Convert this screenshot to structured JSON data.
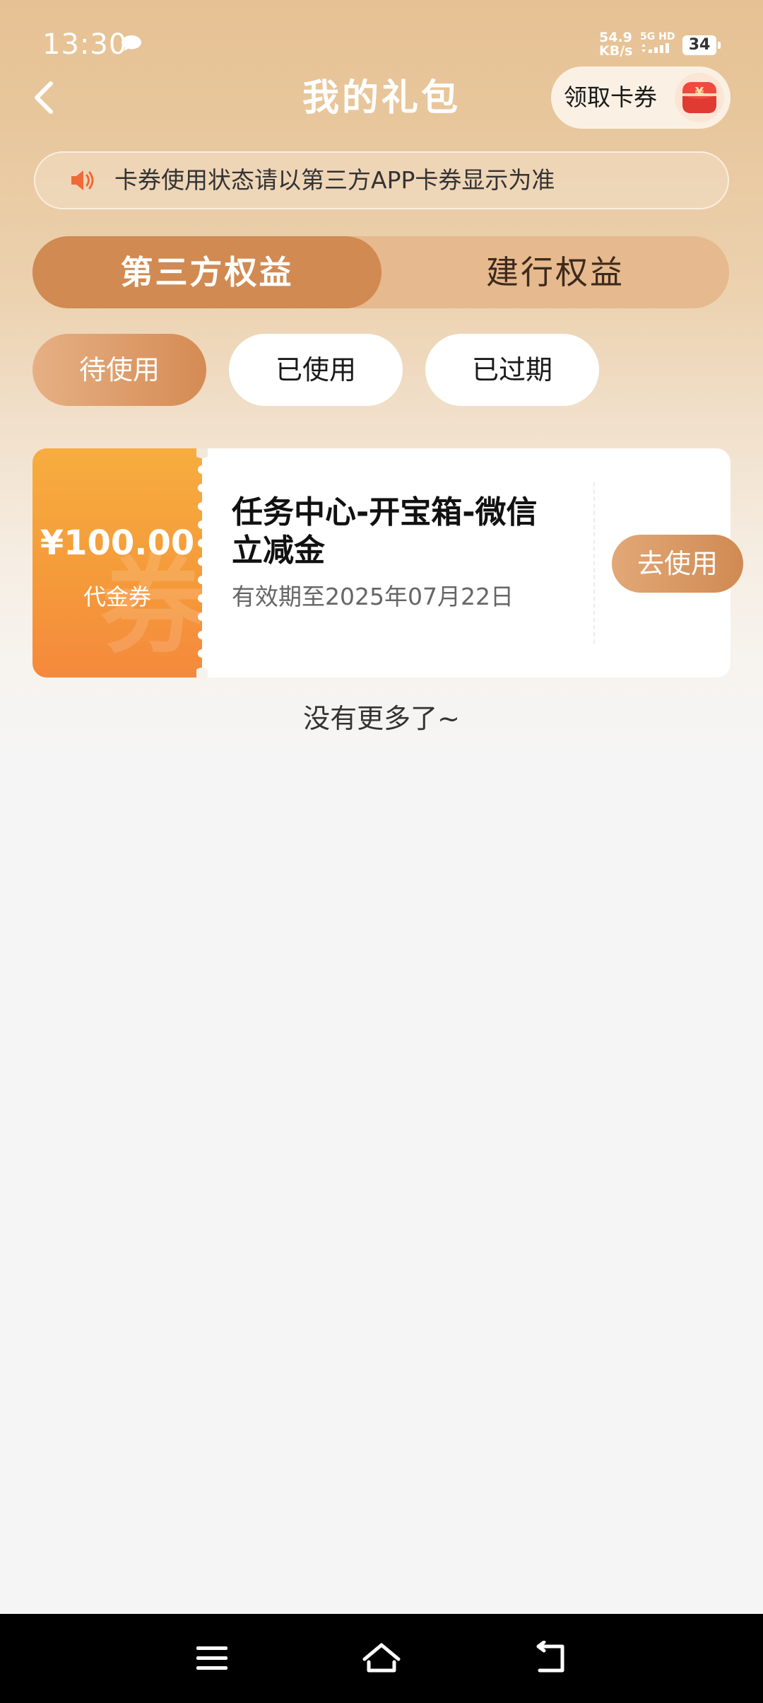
{
  "status_bar": {
    "time": "13:30",
    "speed_value": "54.9",
    "speed_unit": "KB/s",
    "network": "5G HD",
    "battery": "34"
  },
  "header": {
    "title": "我的礼包",
    "get_coupon_label": "领取卡券",
    "get_coupon_icon": "¥"
  },
  "notice": {
    "text": "卡券使用状态请以第三方APP卡券显示为准"
  },
  "tabs": [
    {
      "label": "第三方权益",
      "active": true
    },
    {
      "label": "建行权益",
      "active": false
    }
  ],
  "filters": [
    {
      "label": "待使用",
      "active": true
    },
    {
      "label": "已使用",
      "active": false
    },
    {
      "label": "已过期",
      "active": false
    }
  ],
  "coupons": [
    {
      "amount": "¥100.00",
      "type": "代金券",
      "watermark": "券",
      "title": "任务中心-开宝箱-微信立减金",
      "expiry": "有效期至2025年07月22日",
      "action_label": "去使用"
    }
  ],
  "footer": {
    "no_more": "没有更多了~"
  },
  "colors": {
    "accent": "#d08a52",
    "coupon_orange": "#f59b3a",
    "background": "#f5f5f5"
  }
}
